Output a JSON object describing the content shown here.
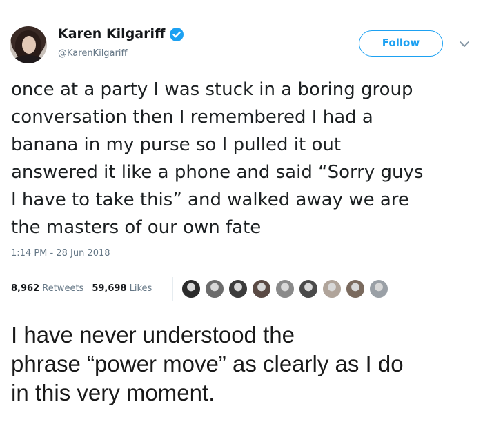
{
  "tweet": {
    "author_name": "Karen Kilgariff",
    "author_handle": "@KarenKilgariff",
    "verified": true,
    "follow_label": "Follow",
    "text": "once at a party I was stuck in a boring group\nconversation then I remembered I had a\nbanana in my purse so I pulled it out\nanswered it like a phone and said “Sorry guys\nI have to take this” and walked away we are\nthe masters of our own fate",
    "timestamp": "1:14 PM - 28 Jun 2018",
    "retweets_count": "8,962",
    "retweets_label": "Retweets",
    "likes_count": "59,698",
    "likes_label": "Likes",
    "liker_avatar_colors": [
      "#2b2b2b",
      "#6c6c6c",
      "#3c3c3c",
      "#5a4a44",
      "#8a8a8a",
      "#4a4a4a",
      "#b0a49a",
      "#7a6a5e",
      "#9aa0a6"
    ]
  },
  "caption": {
    "text": "I have never understood the\nphrase “power move” as clearly as I do\nin this very moment."
  },
  "colors": {
    "accent": "#1da1f2",
    "muted": "#657786",
    "text": "#1c2022"
  }
}
